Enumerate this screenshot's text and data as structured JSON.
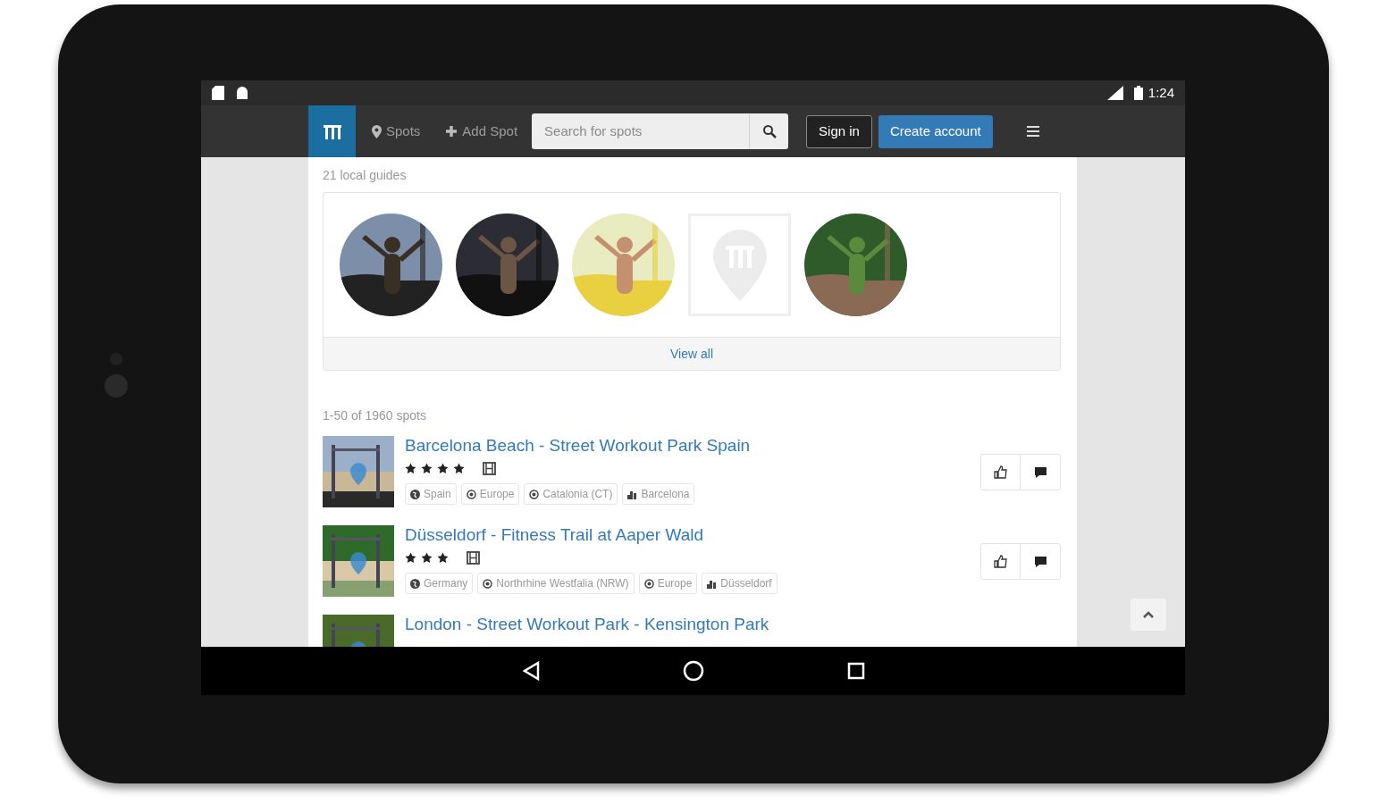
{
  "status_bar": {
    "time": "1:24"
  },
  "navbar": {
    "links": [
      {
        "kind": "spots",
        "label": "Spots"
      },
      {
        "kind": "add",
        "label": "Add Spot"
      }
    ],
    "search": {
      "placeholder": "Search for spots"
    },
    "sign_in": "Sign in",
    "create_account": "Create account"
  },
  "guides": {
    "heading": "21 local guides",
    "avatars": [
      {
        "kind": "picture"
      },
      {
        "kind": "picture"
      },
      {
        "kind": "picture"
      },
      {
        "kind": "placeholder"
      },
      {
        "kind": "picture"
      }
    ],
    "view_all": "View all"
  },
  "spots": {
    "count": "1-50 of 1960 spots",
    "rows": [
      {
        "title": "Barcelona Beach - Street Workout Park Spain",
        "stars": 4,
        "tags": [
          {
            "kind": "country",
            "label": "Spain"
          },
          {
            "kind": "region",
            "label": "Europe"
          },
          {
            "kind": "region",
            "label": "Catalonia (CT)"
          },
          {
            "kind": "city",
            "label": "Barcelona"
          }
        ]
      },
      {
        "title": "Düsseldorf - Fitness Trail at Aaper Wald",
        "stars": 3,
        "tags": [
          {
            "kind": "country",
            "label": "Germany"
          },
          {
            "kind": "region",
            "label": "Northrhine Westfalia (NRW)"
          },
          {
            "kind": "region",
            "label": "Europe"
          },
          {
            "kind": "city",
            "label": "Düsseldorf"
          }
        ]
      },
      {
        "title": "London - Street Workout Park - Kensington Park"
      }
    ]
  }
}
